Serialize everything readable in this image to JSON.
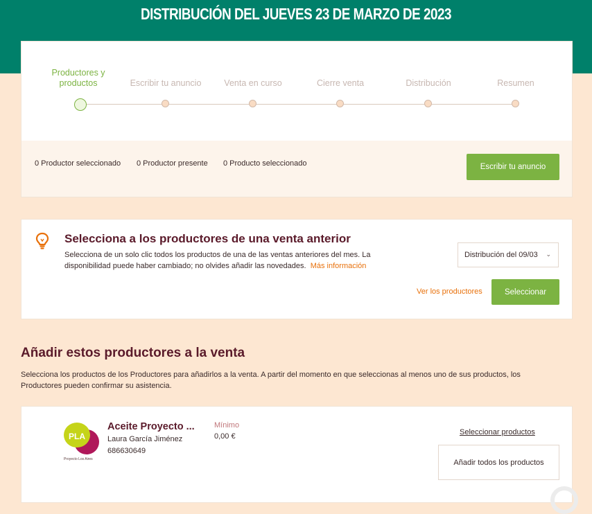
{
  "header": {
    "title": "DISTRIBUCIÓN DEL JUEVES 23 DE MARZO DE 2023"
  },
  "steps": [
    {
      "label": "Productores y productos",
      "active": true
    },
    {
      "label": "Escribir tu anuncio",
      "active": false
    },
    {
      "label": "Venta en curso",
      "active": false
    },
    {
      "label": "Cierre venta",
      "active": false
    },
    {
      "label": "Distribución",
      "active": false
    },
    {
      "label": "Resumen",
      "active": false
    }
  ],
  "summary": {
    "producers_selected": "0 Productor seleccionado",
    "producers_present": "0 Productor presente",
    "products_selected": "0 Producto seleccionado",
    "write_ad_button": "Escribir tu anuncio"
  },
  "previous_sale": {
    "title": "Selecciona a los productores de una venta anterior",
    "description": "Selecciona de un solo clic todos los productos de una de las ventas anteriores del mes. La disponibilidad puede haber cambiado; no olvides añadir las novedades.",
    "more_info_link": "Más información",
    "select_value": "Distribución del 09/03",
    "view_producers_link": "Ver los productores",
    "select_button": "Seleccionar"
  },
  "add_section": {
    "title": "Añadir estos productores a la venta",
    "description": "Selecciona los productos de los Productores para añadirlos a la venta. A partir del momento en que seleccionas al menos uno de sus productos, los Productores pueden confirmar su asistencia."
  },
  "producer": {
    "logo_text": "PLA",
    "logo_caption": "Proyecto Los Aires",
    "name": "Aceite Proyecto ...",
    "person": "Laura García Jiménez",
    "phone": "686630649",
    "minimum_label": "Mínimo",
    "minimum_value": "0,00 €",
    "select_products_link": "Seleccionar productos",
    "add_all_button": "Añadir todos los productos"
  },
  "colors": {
    "header_green": "#00806a",
    "accent_green": "#7cb342",
    "accent_orange": "#e8700a",
    "title_maroon": "#5a1a2a",
    "page_background": "#fde7d2"
  }
}
